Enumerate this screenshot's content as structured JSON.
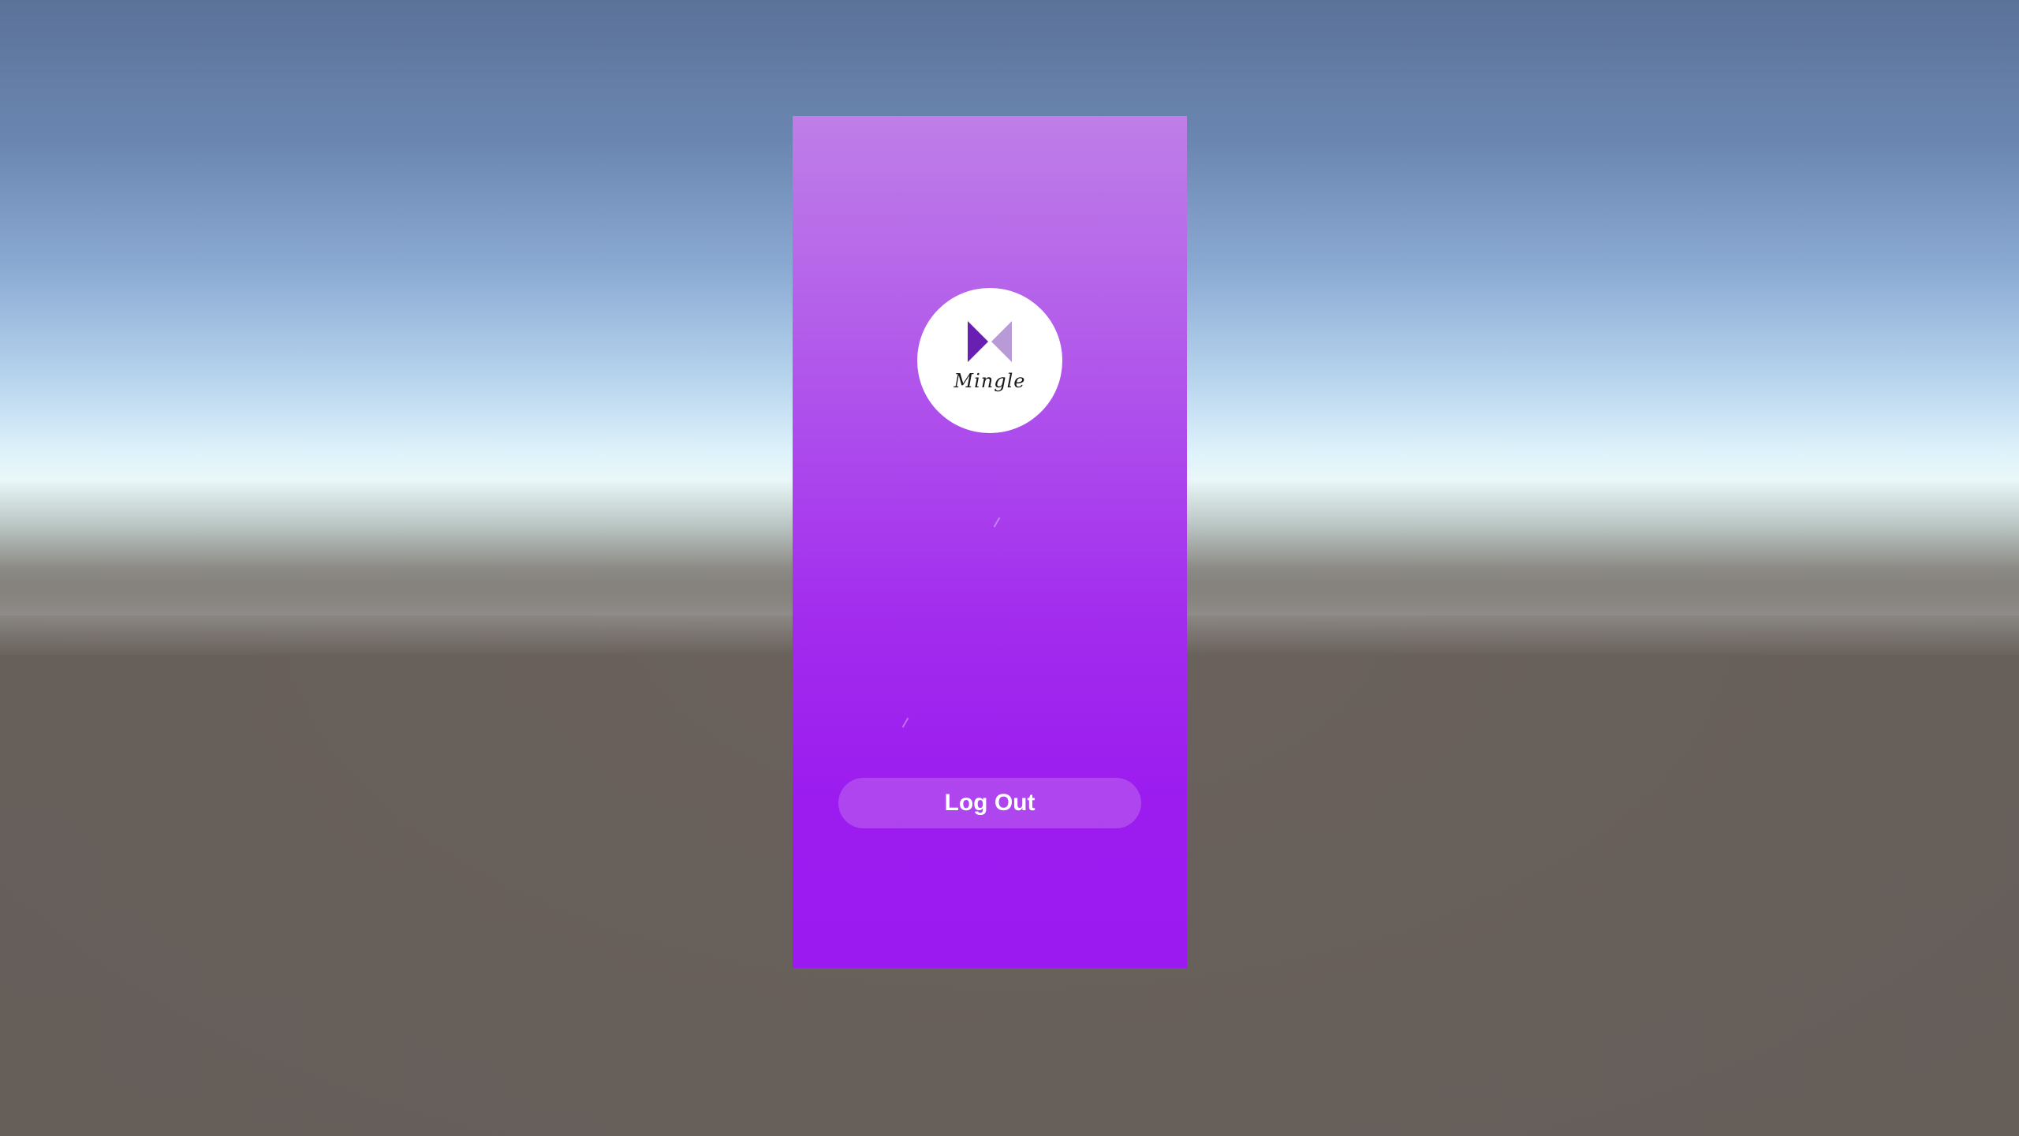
{
  "app": {
    "logo_text": "Mingle",
    "logo_icon": "bowtie-logo-icon"
  },
  "actions": {
    "logout_label": "Log Out"
  },
  "colors": {
    "panel_top": "#be7ee7",
    "panel_bottom": "#9a1af0",
    "logo_dark": "#6a1fb3",
    "logo_light": "#b79ad6"
  }
}
